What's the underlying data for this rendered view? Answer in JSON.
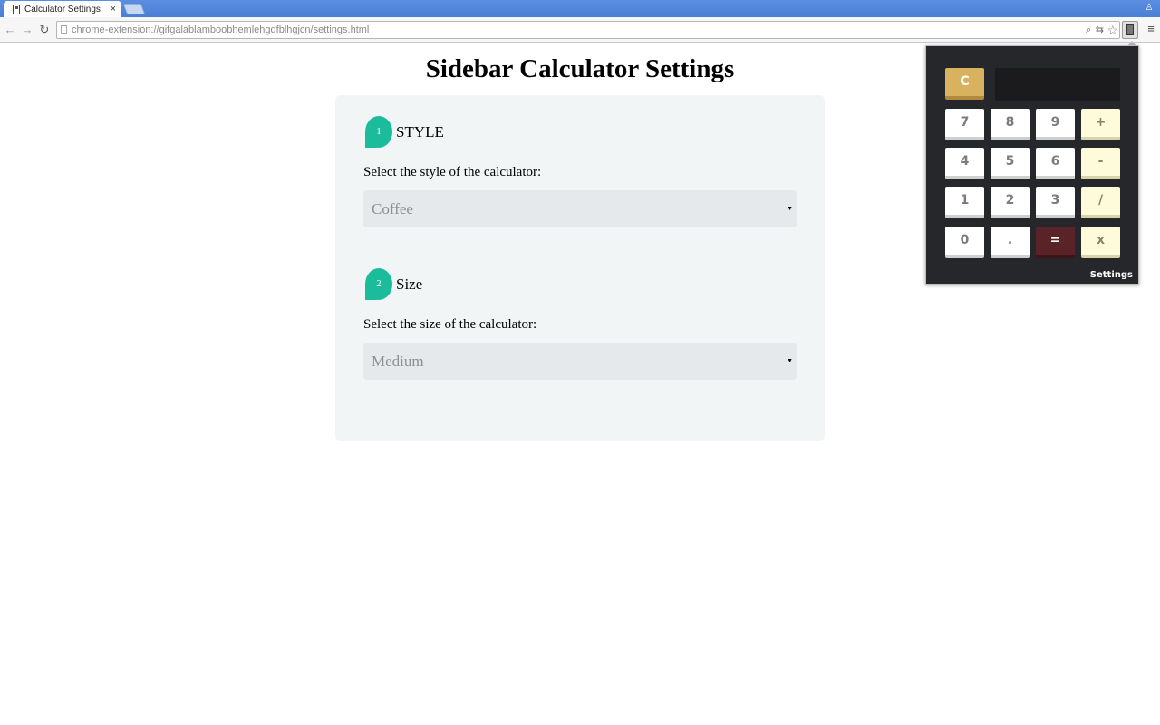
{
  "browser": {
    "tab_title": "Calculator Settings",
    "tab_close": "×",
    "address": "chrome-extension://gifgalablamboobhemlehgdfblhgjcn/settings.html",
    "back_icon": "←",
    "forward_icon": "→",
    "reload_icon": "↻",
    "zoom_icon": "⌕",
    "translate_icon": "⇆",
    "star_icon": "☆",
    "menu_icon": "≡",
    "profile_icon": "♙"
  },
  "page": {
    "title": "Sidebar Calculator Settings",
    "steps": [
      {
        "number": "1",
        "heading": "STYLE",
        "description": "Select the style of the calculator:",
        "selected": "Coffee"
      },
      {
        "number": "2",
        "heading": "Size",
        "description": "Select the size of the calculator:",
        "selected": "Medium"
      }
    ],
    "select_arrow": "▼"
  },
  "calculator": {
    "display_value": "",
    "clear_label": "C",
    "keys": {
      "k7": "7",
      "k8": "8",
      "k9": "9",
      "plus": "+",
      "k4": "4",
      "k5": "5",
      "k6": "6",
      "minus": "-",
      "k1": "1",
      "k2": "2",
      "k3": "3",
      "divide": "/",
      "k0": "0",
      "dot": ".",
      "equals": "=",
      "multiply": "x"
    },
    "settings_label": "Settings"
  },
  "colors": {
    "accent_teal": "#1abc9c",
    "popup_bg": "#26272b",
    "clear_key": "#d9b25f",
    "equals_key": "#5a2327",
    "operator_key": "#fdfbd9"
  }
}
